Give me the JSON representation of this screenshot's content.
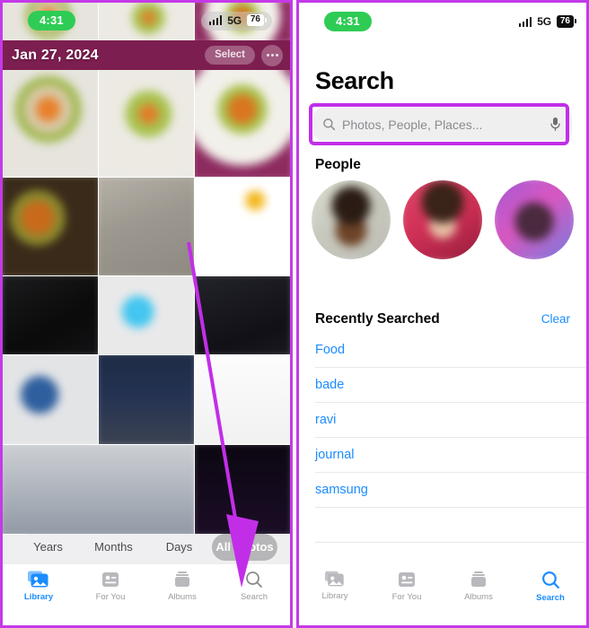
{
  "meta": {
    "accent_purple": "#c22ee8",
    "ios_blue": "#1a8cff",
    "time_pill_green": "#2ecc55"
  },
  "left_panel": {
    "status": {
      "time": "4:31",
      "network": "5G",
      "battery": "76",
      "signal_icon": "signal-bars-icon"
    },
    "date_header": {
      "date": "Jan 27, 2024",
      "select_label": "Select",
      "more_icon": "ellipsis-icon"
    },
    "segmented": {
      "options": [
        "Years",
        "Months",
        "Days",
        "All Photos"
      ],
      "selected": "All Photos"
    },
    "tabs": [
      {
        "label": "Library",
        "icon": "photos-library-icon",
        "active": true
      },
      {
        "label": "For You",
        "icon": "for-you-icon",
        "active": false
      },
      {
        "label": "Albums",
        "icon": "albums-icon",
        "active": false
      },
      {
        "label": "Search",
        "icon": "search-icon",
        "active": false
      }
    ],
    "annotation": {
      "type": "arrow",
      "color": "#c22ee8",
      "points_to": "Search"
    }
  },
  "right_panel": {
    "status": {
      "time": "4:31",
      "network": "5G",
      "battery": "76",
      "signal_icon": "signal-bars-icon"
    },
    "title": "Search",
    "search": {
      "placeholder": "Photos, People, Places...",
      "value": "",
      "leading_icon": "magnifier-icon",
      "trailing_icon": "microphone-icon",
      "highlighted": true
    },
    "people": {
      "heading": "People",
      "avatars": [
        "person-1",
        "person-2",
        "person-3",
        "person-4"
      ]
    },
    "recently_searched": {
      "heading": "Recently Searched",
      "clear_label": "Clear",
      "items": [
        "Food",
        "bade",
        "ravi",
        "journal",
        "samsung"
      ]
    },
    "tabs": [
      {
        "label": "Library",
        "icon": "photos-library-icon",
        "active": false
      },
      {
        "label": "For You",
        "icon": "for-you-icon",
        "active": false
      },
      {
        "label": "Albums",
        "icon": "albums-icon",
        "active": false
      },
      {
        "label": "Search",
        "icon": "search-icon",
        "active": true
      }
    ]
  }
}
